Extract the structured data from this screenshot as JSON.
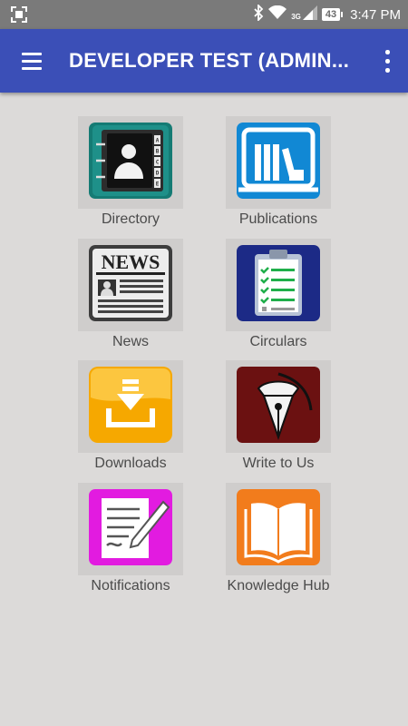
{
  "status_bar": {
    "network": "3G",
    "battery": "43",
    "time": "3:47 PM"
  },
  "app_bar": {
    "title": "DEVELOPER TEST (ADMIN..."
  },
  "menu_items": [
    {
      "label": "Directory",
      "icon": "directory-icon",
      "color": "#157b74"
    },
    {
      "label": "Publications",
      "icon": "publications-icon",
      "color": "#1188d4"
    },
    {
      "label": "News",
      "icon": "news-icon",
      "color": "#3d3d3d"
    },
    {
      "label": "Circulars",
      "icon": "circulars-icon",
      "color": "#1c2a86"
    },
    {
      "label": "Downloads",
      "icon": "downloads-icon",
      "color": "#f6a800"
    },
    {
      "label": "Write to Us",
      "icon": "pen-nib-icon",
      "color": "#6b1111"
    },
    {
      "label": "Notifications",
      "icon": "notifications-icon",
      "color": "#e21be0"
    },
    {
      "label": "Knowledge Hub",
      "icon": "open-book-icon",
      "color": "#f27c1c"
    }
  ],
  "news_icon_text": "NEWS",
  "directory_tabs": [
    "A",
    "B",
    "C",
    "D",
    "E"
  ],
  "colors": {
    "status_bar": "#7a7a7a",
    "app_bar": "#3b4fb7",
    "background": "#dcdad9"
  }
}
